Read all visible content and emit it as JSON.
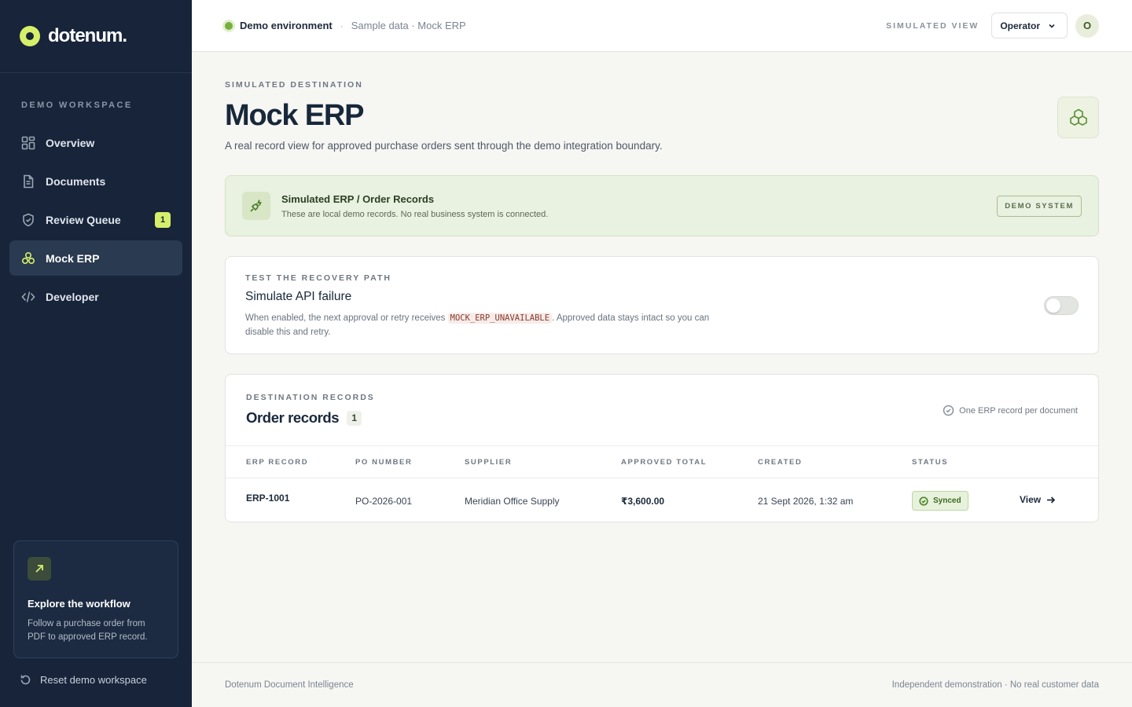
{
  "brand": {
    "name": "dotenum."
  },
  "sidebar": {
    "section_label": "DEMO WORKSPACE",
    "items": [
      {
        "label": "Overview",
        "icon": "grid-icon"
      },
      {
        "label": "Documents",
        "icon": "document-icon"
      },
      {
        "label": "Review Queue",
        "icon": "shield-icon",
        "badge": "1"
      },
      {
        "label": "Mock ERP",
        "icon": "boxes-icon",
        "active": true
      },
      {
        "label": "Developer",
        "icon": "code-icon"
      }
    ],
    "explore": {
      "title": "Explore the workflow",
      "text": "Follow a purchase order from PDF to approved ERP record."
    },
    "reset_label": "Reset demo workspace"
  },
  "topbar": {
    "env_label": "Demo environment",
    "separator": "·",
    "env_sub": "Sample data · Mock ERP",
    "sim_label": "SIMULATED VIEW",
    "role": "Operator",
    "avatar_initial": "O"
  },
  "header": {
    "eyebrow": "SIMULATED DESTINATION",
    "title": "Mock ERP",
    "description": "A real record view for approved purchase orders sent through the demo integration boundary."
  },
  "banner": {
    "title": "Simulated ERP / Order Records",
    "text": "These are local demo records. No real business system is connected.",
    "tag": "DEMO SYSTEM"
  },
  "recovery": {
    "eyebrow": "TEST THE RECOVERY PATH",
    "title": "Simulate API failure",
    "text_before": "When enabled, the next approval or retry receives ",
    "code": "MOCK_ERP_UNAVAILABLE",
    "text_after": ". Approved data stays intact so you can disable this and retry.",
    "toggle_on": false
  },
  "records": {
    "eyebrow": "DESTINATION RECORDS",
    "title": "Order records",
    "count": "1",
    "note": "One ERP record per document",
    "columns": [
      "ERP RECORD",
      "PO NUMBER",
      "SUPPLIER",
      "APPROVED TOTAL",
      "CREATED",
      "STATUS"
    ],
    "rows": [
      {
        "erp_record": "ERP-1001",
        "po_number": "PO-2026-001",
        "supplier": "Meridian Office Supply",
        "approved_total": "₹3,600.00",
        "created": "21 Sept 2026, 1:32 am",
        "status": "Synced",
        "action": "View"
      }
    ]
  },
  "footer": {
    "left": "Dotenum Document Intelligence",
    "right": "Independent demonstration · No real customer data"
  },
  "colors": {
    "sidebar_bg": "#17243a",
    "accent": "#d6ef6a",
    "success": "#4f8a28",
    "page_bg": "#f6f6f3"
  }
}
